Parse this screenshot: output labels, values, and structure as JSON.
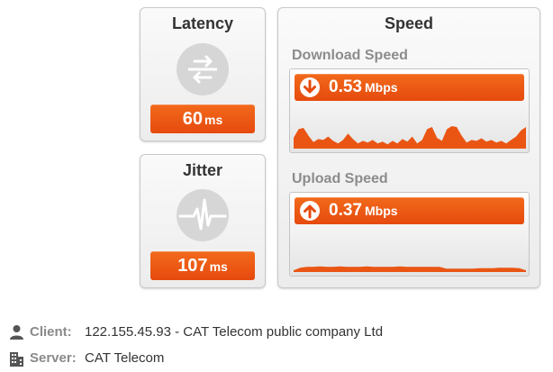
{
  "latency": {
    "title": "Latency",
    "icon": "arrows-left-right-icon",
    "value": "60",
    "unit": "ms"
  },
  "jitter": {
    "title": "Jitter",
    "icon": "waveform-icon",
    "value": "107",
    "unit": "ms"
  },
  "speed": {
    "title": "Speed",
    "download": {
      "title": "Download Speed",
      "icon": "download-arrow-icon",
      "value": "0.53",
      "unit": "Mbps",
      "history": [
        0.25,
        0.45,
        0.48,
        0.3,
        0.15,
        0.22,
        0.2,
        0.28,
        0.18,
        0.12,
        0.2,
        0.35,
        0.22,
        0.12,
        0.18,
        0.14,
        0.2,
        0.12,
        0.16,
        0.1,
        0.18,
        0.12,
        0.22,
        0.16,
        0.28,
        0.12,
        0.2,
        0.45,
        0.5,
        0.25,
        0.18,
        0.45,
        0.52,
        0.5,
        0.3,
        0.14,
        0.2,
        0.18,
        0.24,
        0.16,
        0.2,
        0.14,
        0.18,
        0.12,
        0.2,
        0.28,
        0.42,
        0.5
      ]
    },
    "upload": {
      "title": "Upload Speed",
      "icon": "upload-arrow-icon",
      "value": "0.37",
      "unit": "Mbps",
      "history": [
        0.04,
        0.1,
        0.12,
        0.12,
        0.13,
        0.12,
        0.12,
        0.13,
        0.12,
        0.12,
        0.12,
        0.13,
        0.12,
        0.12,
        0.12,
        0.12,
        0.13,
        0.12,
        0.12,
        0.12,
        0.12,
        0.12,
        0.12,
        0.08,
        0.08,
        0.08,
        0.08,
        0.08,
        0.09,
        0.09,
        0.09,
        0.1,
        0.1,
        0.1,
        0.09,
        0.04
      ]
    }
  },
  "client": {
    "label": "Client:",
    "icon": "person-icon",
    "value": "122.155.45.93 - CAT Telecom public company Ltd"
  },
  "server": {
    "label": "Server:",
    "icon": "building-icon",
    "value": "CAT Telecom"
  },
  "colors": {
    "accent": "#ea5513",
    "icon_gray": "#d6d6d6"
  }
}
